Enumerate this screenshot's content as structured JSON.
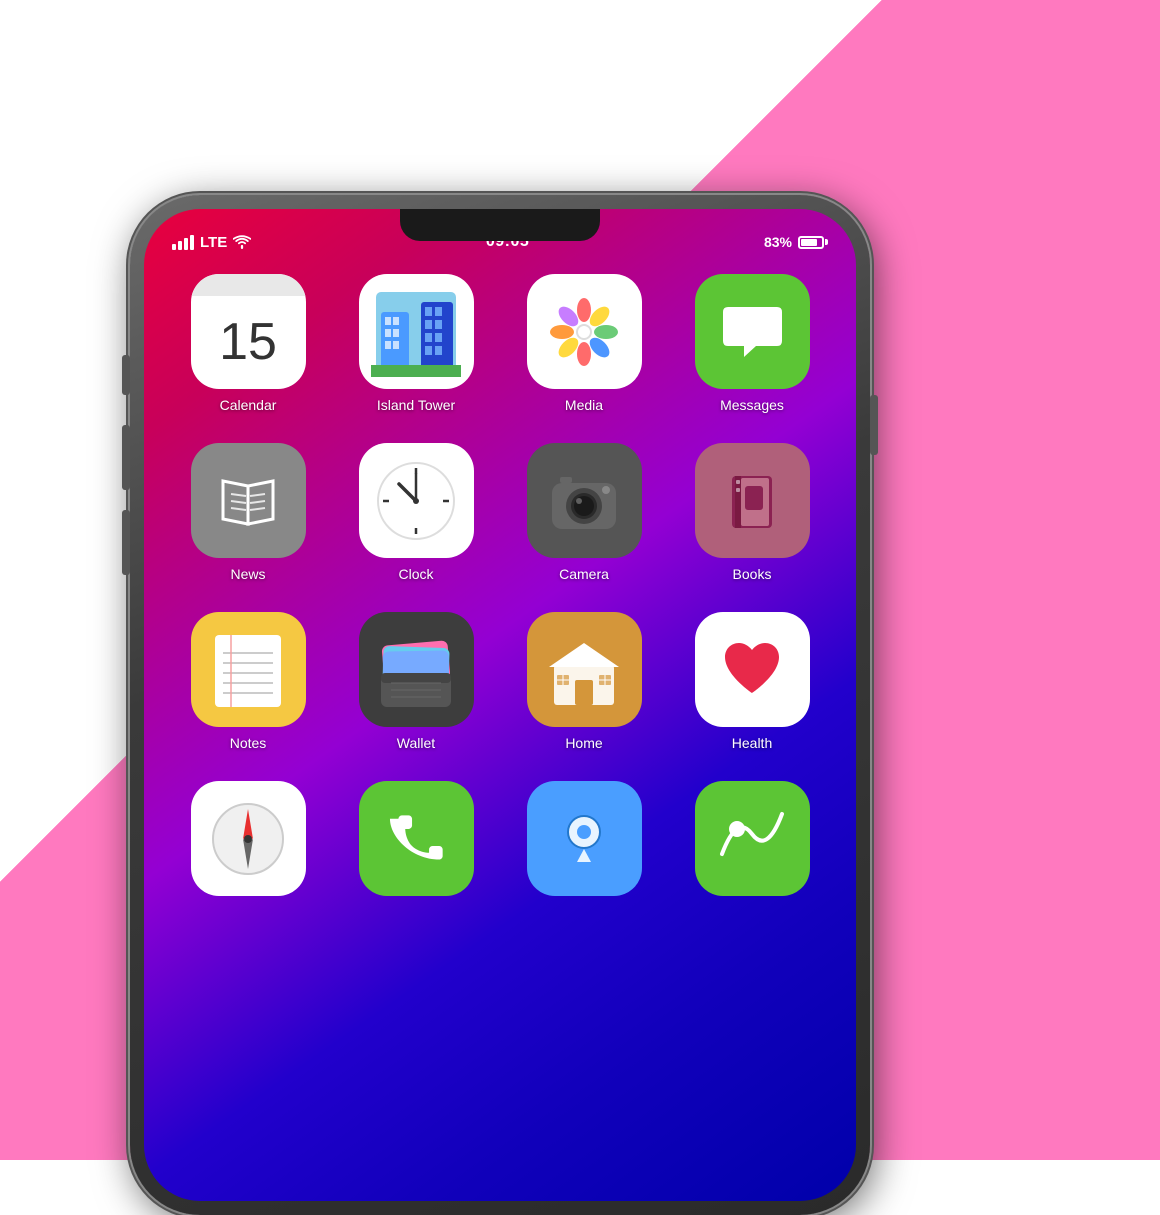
{
  "background": {
    "left_color": "#ffffff",
    "right_gradient": [
      "#ff69b4",
      "#ffb3d9"
    ]
  },
  "status_bar": {
    "signal_label": "LTE",
    "time": "09:05",
    "battery_percent": "83%"
  },
  "apps": {
    "row1": [
      {
        "id": "calendar",
        "label": "Calendar",
        "date": "15"
      },
      {
        "id": "island-tower",
        "label": "Island Tower"
      },
      {
        "id": "media",
        "label": "Media"
      },
      {
        "id": "messages",
        "label": "Messages"
      }
    ],
    "row2": [
      {
        "id": "news",
        "label": "News"
      },
      {
        "id": "clock",
        "label": "Clock"
      },
      {
        "id": "camera",
        "label": "Camera"
      },
      {
        "id": "books",
        "label": "Books"
      }
    ],
    "row3": [
      {
        "id": "notes",
        "label": "Notes"
      },
      {
        "id": "wallet",
        "label": "Wallet"
      },
      {
        "id": "home",
        "label": "Home"
      },
      {
        "id": "health",
        "label": "Health"
      }
    ],
    "row4": [
      {
        "id": "compass",
        "label": ""
      },
      {
        "id": "phone",
        "label": ""
      },
      {
        "id": "maps",
        "label": ""
      },
      {
        "id": "app4",
        "label": ""
      }
    ]
  }
}
